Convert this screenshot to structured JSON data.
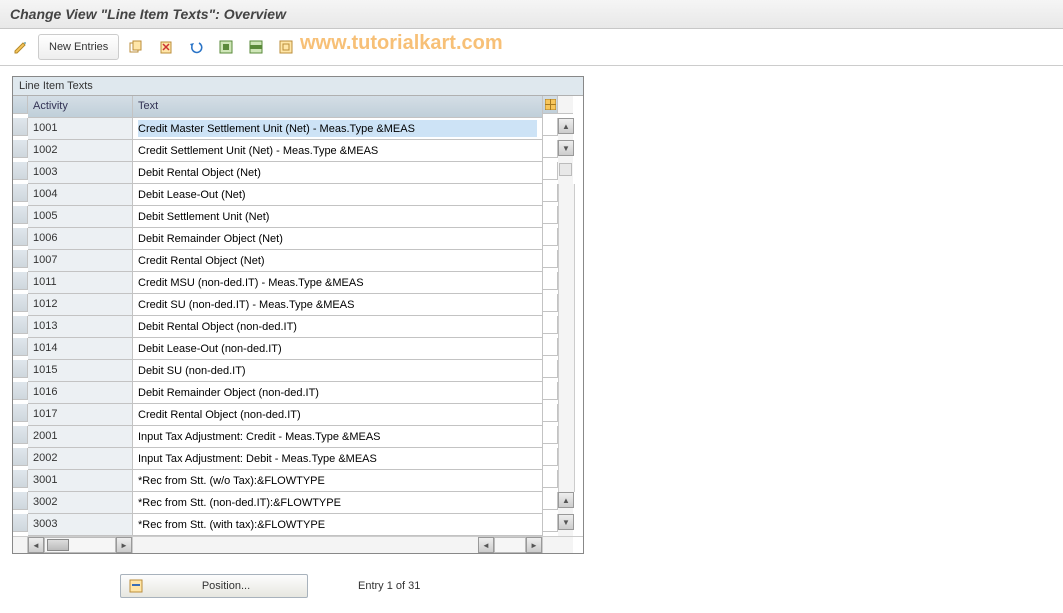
{
  "title": "Change View \"Line Item Texts\": Overview",
  "watermark": "www.tutorialkart.com",
  "toolbar": {
    "new_entries_label": "New Entries"
  },
  "panel": {
    "title": "Line Item Texts",
    "columns": {
      "activity": "Activity",
      "text": "Text"
    },
    "rows": [
      {
        "activity": "1001",
        "text": "Credit Master Settlement Unit (Net) - Meas.Type &MEAS"
      },
      {
        "activity": "1002",
        "text": "Credit Settlement Unit (Net) - Meas.Type &MEAS"
      },
      {
        "activity": "1003",
        "text": "Debit Rental Object (Net)"
      },
      {
        "activity": "1004",
        "text": "Debit Lease-Out (Net)"
      },
      {
        "activity": "1005",
        "text": "Debit Settlement Unit (Net)"
      },
      {
        "activity": "1006",
        "text": "Debit Remainder Object (Net)"
      },
      {
        "activity": "1007",
        "text": "Credit Rental Object (Net)"
      },
      {
        "activity": "1011",
        "text": "Credit MSU (non-ded.IT) - Meas.Type &MEAS"
      },
      {
        "activity": "1012",
        "text": "Credit SU (non-ded.IT) - Meas.Type &MEAS"
      },
      {
        "activity": "1013",
        "text": "Debit Rental Object (non-ded.IT)"
      },
      {
        "activity": "1014",
        "text": "Debit Lease-Out (non-ded.IT)"
      },
      {
        "activity": "1015",
        "text": "Debit SU (non-ded.IT)"
      },
      {
        "activity": "1016",
        "text": "Debit Remainder Object (non-ded.IT)"
      },
      {
        "activity": "1017",
        "text": "Credit Rental Object (non-ded.IT)"
      },
      {
        "activity": "2001",
        "text": "Input Tax Adjustment: Credit - Meas.Type &MEAS"
      },
      {
        "activity": "2002",
        "text": "Input Tax Adjustment: Debit - Meas.Type &MEAS"
      },
      {
        "activity": "3001",
        "text": "*Rec from Stt. (w/o Tax):&FLOWTYPE"
      },
      {
        "activity": "3002",
        "text": "*Rec from Stt. (non-ded.IT):&FLOWTYPE"
      },
      {
        "activity": "3003",
        "text": "*Rec from Stt. (with tax):&FLOWTYPE"
      }
    ],
    "selected_row_index": 0
  },
  "footer": {
    "position_label": "Position...",
    "entry_status": "Entry 1 of 31"
  }
}
